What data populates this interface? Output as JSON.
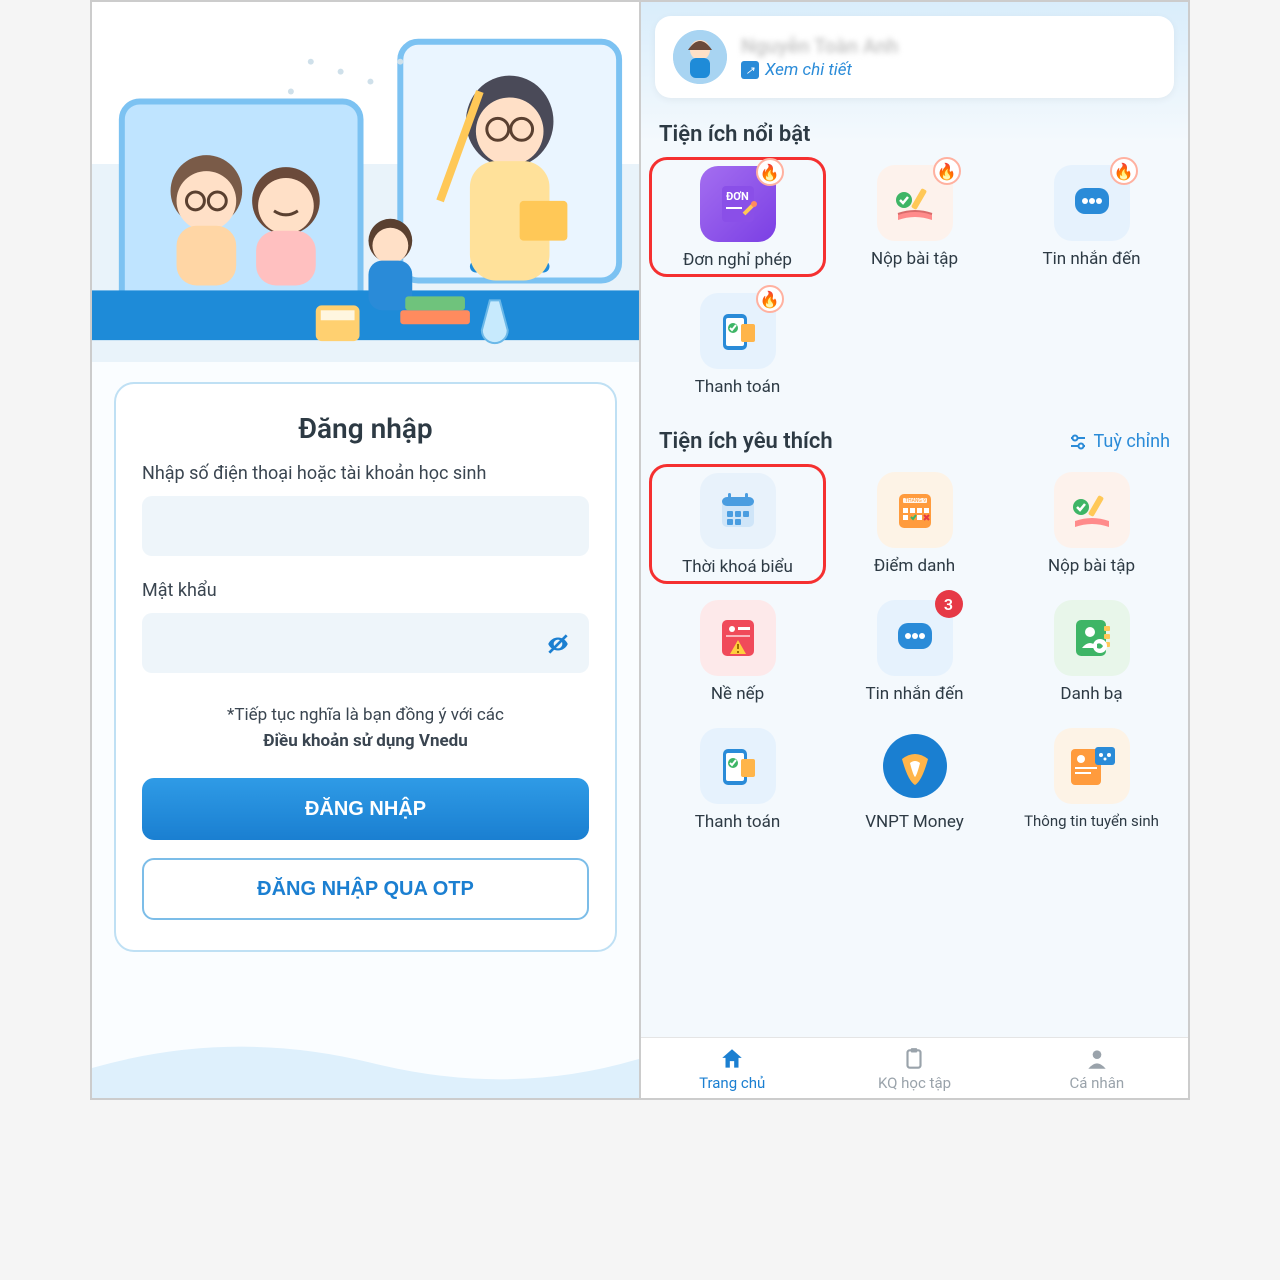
{
  "left": {
    "title": "Đăng nhập",
    "username_label": "Nhập số điện thoại hoặc tài khoản học sinh",
    "password_label": "Mật khẩu",
    "terms_prefix": "*Tiếp tục nghĩa là bạn đồng ý với các",
    "terms_bold": "Điều khoản sử dụng Vnedu",
    "login_btn": "ĐĂNG NHẬP",
    "otp_btn": "ĐĂNG NHẬP QUA OTP"
  },
  "right": {
    "profile_link": "Xem chi tiết",
    "section_featured": "Tiện ích nổi bật",
    "section_favorite": "Tiện ích yêu thích",
    "customize": "Tuỳ chỉnh",
    "featured": [
      {
        "label": "Đơn nghỉ phép",
        "highlight": true,
        "hot": true
      },
      {
        "label": "Nộp bài tập",
        "hot": true
      },
      {
        "label": "Tin nhắn đến",
        "hot": true
      },
      {
        "label": "Thanh toán",
        "hot": true
      }
    ],
    "favorites": [
      {
        "label": "Thời khoá biểu",
        "highlight": true
      },
      {
        "label": "Điểm danh"
      },
      {
        "label": "Nộp bài tập"
      },
      {
        "label": "Nề nếp"
      },
      {
        "label": "Tin nhắn đến",
        "count": 3
      },
      {
        "label": "Danh bạ"
      },
      {
        "label": "Thanh toán"
      },
      {
        "label": "VNPT Money"
      },
      {
        "label": "Thông tin tuyển sinh"
      }
    ],
    "nav": [
      {
        "label": "Trang chủ",
        "active": true
      },
      {
        "label": "KQ học tập"
      },
      {
        "label": "Cá nhân"
      }
    ]
  },
  "colors": {
    "accent": "#1b7fd1"
  }
}
